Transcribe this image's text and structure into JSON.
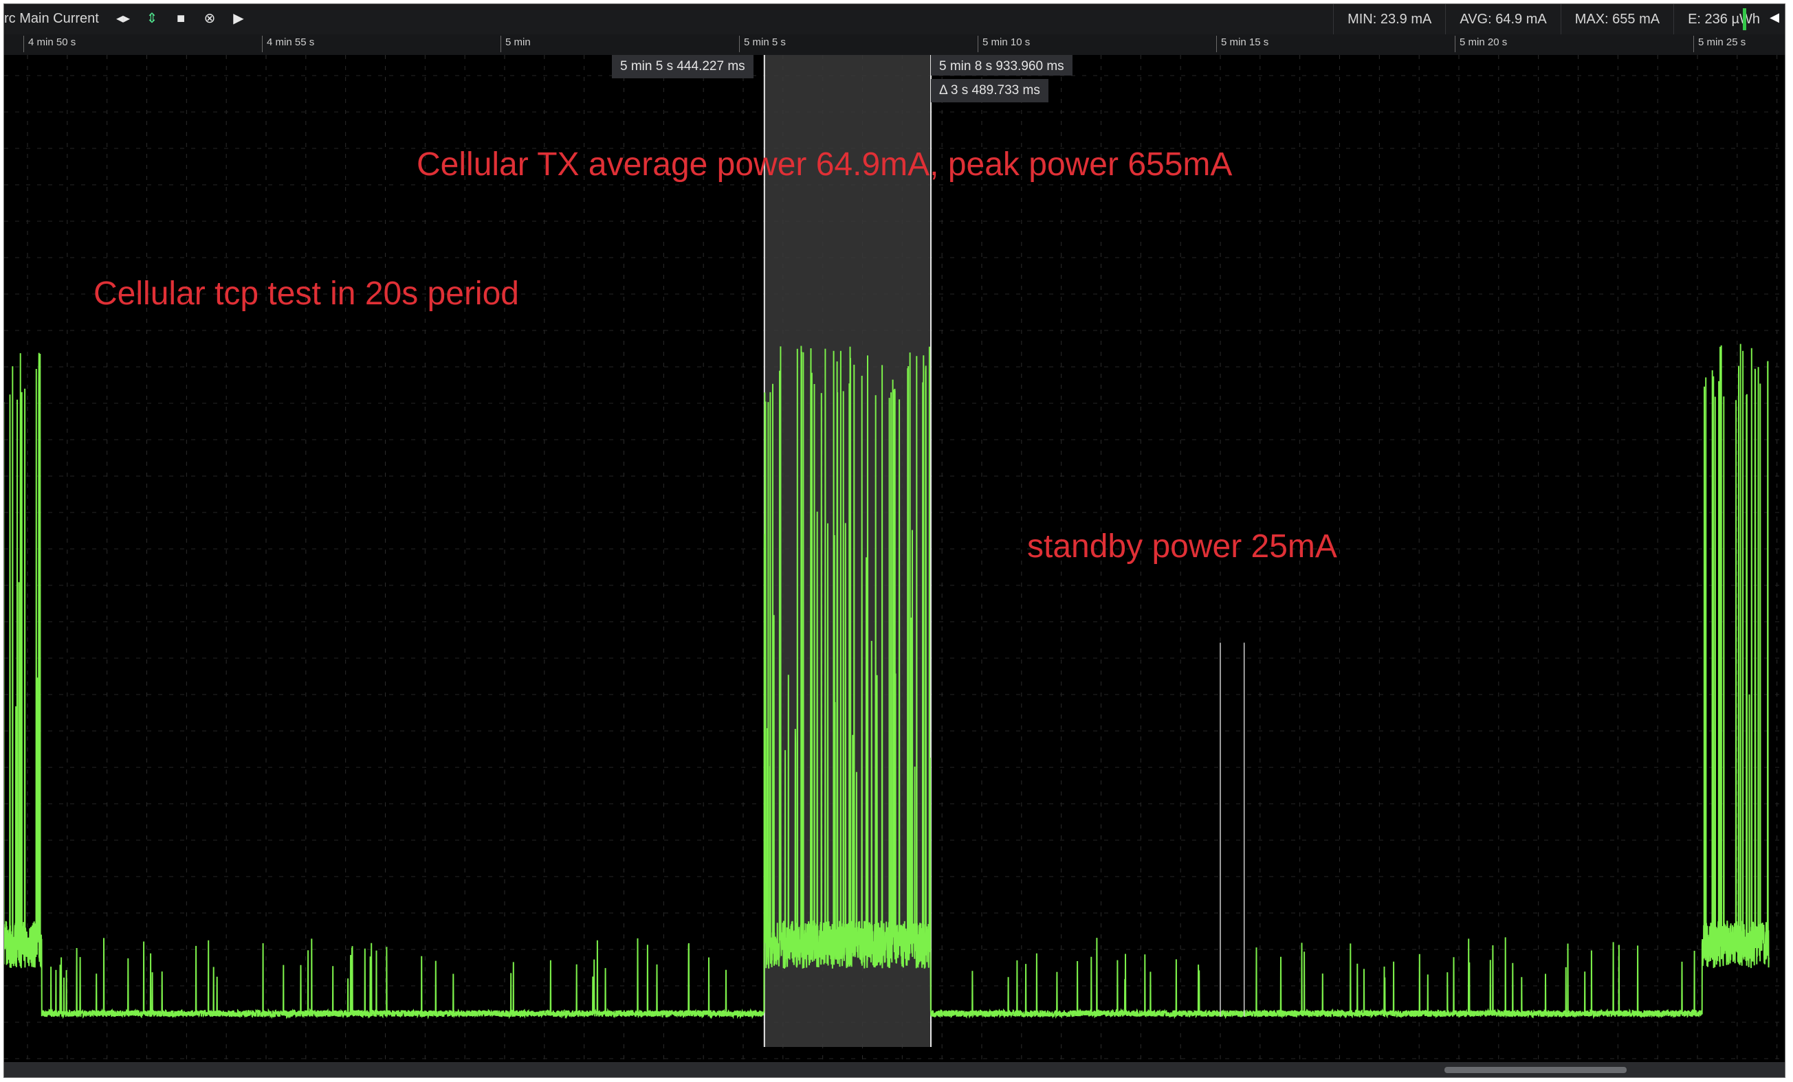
{
  "toolbar": {
    "title": "rc Main Current",
    "icons": [
      "left-right-arrows-icon",
      "up-down-arrows-icon",
      "stop-icon",
      "close-circle-icon",
      "play-step-icon"
    ]
  },
  "stats": {
    "min": "MIN: 23.9 mA",
    "avg": "AVG: 64.9 mA",
    "max": "MAX: 655 mA",
    "energy": "E: 236 µWh"
  },
  "ruler": {
    "ticks": [
      "4 min 50 s",
      "4 min 55 s",
      "5 min",
      "5 min 5 s",
      "5 min 10 s",
      "5 min 15 s",
      "5 min 20 s",
      "5 min 25 s"
    ]
  },
  "cursors": {
    "left": "5 min 5 s 444.227 ms",
    "right": "5 min 8 s 933.960 ms",
    "delta": "Δ 3 s 489.733 ms"
  },
  "annotations": {
    "tx": "Cellular TX average power 64.9mA, peak power 655mA",
    "period": "Cellular tcp test in 20s period",
    "standby": "standby power 25mA"
  },
  "colors": {
    "trace": "#7cf04a",
    "annotation": "#e03036",
    "background": "#000000",
    "selection": "#3a3a3a"
  },
  "chart_data": {
    "type": "line",
    "x_unit": "s",
    "y_unit": "mA",
    "x_range_s": [
      289,
      326.5
    ],
    "ylim": [
      0,
      700
    ],
    "grid": true,
    "series": [
      {
        "name": "rc Main Current",
        "baseline_mA": 25,
        "peak_mA": 655,
        "burst_windows_s": [
          [
            289.0,
            290.3
          ],
          [
            305.44,
            308.93
          ],
          [
            325.1,
            326.5
          ]
        ],
        "standby_spikes_s": [
          315.0,
          315.5
        ]
      }
    ],
    "selection_s": [
      305.444,
      308.934
    ]
  }
}
